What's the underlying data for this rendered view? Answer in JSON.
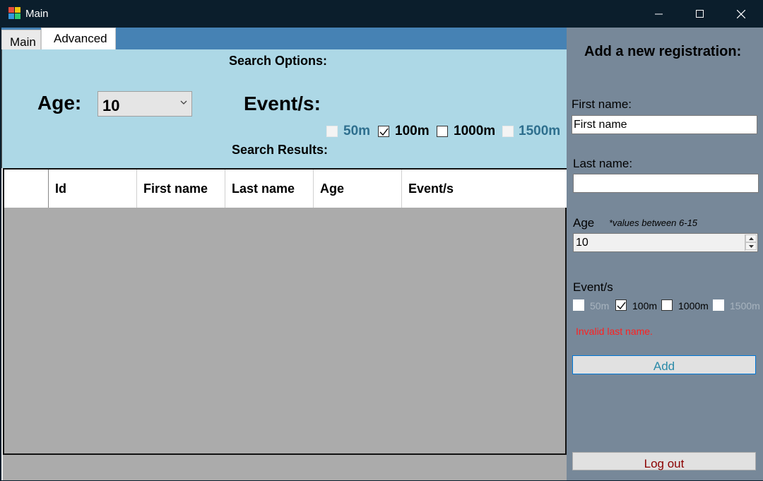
{
  "window": {
    "title": "Main"
  },
  "tabs": [
    {
      "label": "Main",
      "selected": false
    },
    {
      "label": "Advanced",
      "selected": true
    }
  ],
  "search": {
    "options_label": "Search Options:",
    "age_label": "Age:",
    "age_value": "10",
    "events_label": "Event/s:",
    "events": [
      {
        "label": "50m",
        "checked": false,
        "enabled": false,
        "color": "#2e6f8e"
      },
      {
        "label": "100m",
        "checked": true,
        "enabled": true,
        "color": "#000000"
      },
      {
        "label": "1000m",
        "checked": false,
        "enabled": true,
        "color": "#000000"
      },
      {
        "label": "1500m",
        "checked": false,
        "enabled": false,
        "color": "#2e6f8e"
      }
    ],
    "results_label": "Search Results:"
  },
  "grid": {
    "columns": [
      "",
      "Id",
      "First name",
      "Last name",
      "Age",
      "Event/s"
    ],
    "rows": []
  },
  "registration": {
    "title": "Add a new registration:",
    "first_name_label": "First name:",
    "first_name_value": "First name",
    "last_name_label": "Last name:",
    "last_name_value": "",
    "age_label": "Age",
    "age_hint": "*values between 6-15",
    "age_value": "10",
    "events_label": "Event/s",
    "events": [
      {
        "label": "50m",
        "checked": false,
        "enabled": false
      },
      {
        "label": "100m",
        "checked": true,
        "enabled": true
      },
      {
        "label": "1000m",
        "checked": false,
        "enabled": true
      },
      {
        "label": "1500m",
        "checked": false,
        "enabled": false
      }
    ],
    "error": "Invalid last name.",
    "add_label": "Add",
    "logout_label": "Log out"
  },
  "colors": {
    "tabstrip": "#4682b4",
    "search_panel": "#add8e6",
    "side_panel": "#778899",
    "error": "#ff2020"
  }
}
